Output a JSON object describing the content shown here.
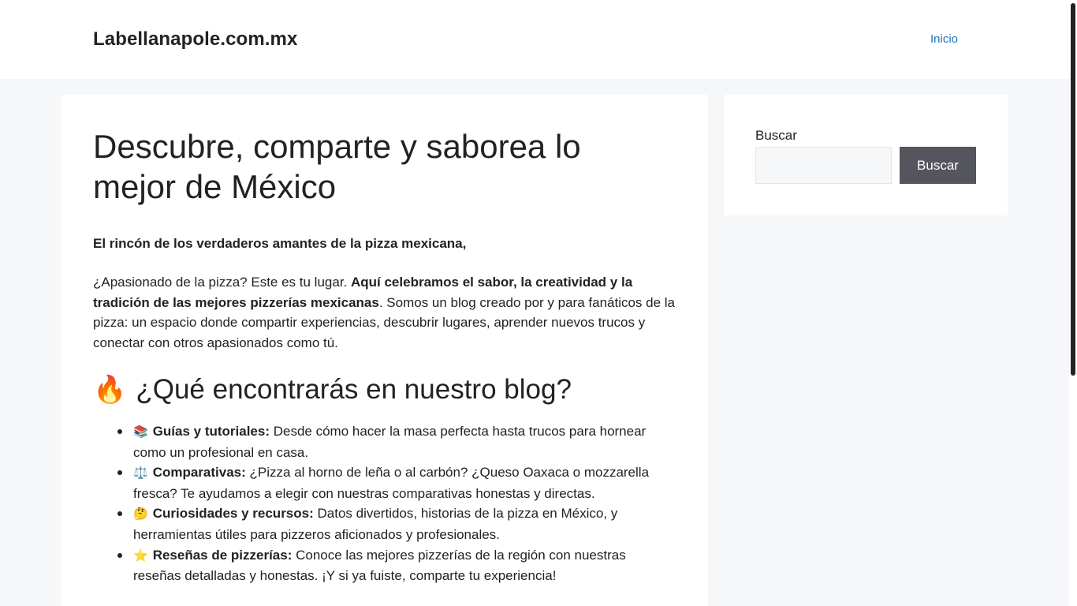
{
  "header": {
    "site_title": "Labellanapole.com.mx",
    "nav": {
      "home_label": "Inicio"
    }
  },
  "main": {
    "title": "Descubre, comparte y saborea lo mejor de México",
    "intro_bold": "El rincón de los verdaderos amantes de la pizza mexicana,",
    "paragraph": {
      "part1": "¿Apasionado de la pizza? Este es tu lugar. ",
      "bold": "Aquí celebramos el sabor, la creatividad y la tradición de las mejores pizzerías mexicanas",
      "part2": ". Somos un blog creado por y para fanáticos de la pizza: un espacio donde compartir experiencias, descubrir lugares, aprender nuevos trucos y conectar con otros apasionados como tú."
    },
    "section_heading": {
      "emoji": "🔥",
      "text": "¿Qué encontrarás en nuestro blog?"
    },
    "features": [
      {
        "emoji": "📚",
        "title": "Guías y tutoriales:",
        "text": " Desde cómo hacer la masa perfecta hasta trucos para hornear como un profesional en casa."
      },
      {
        "emoji": "⚖️",
        "title": "Comparativas:",
        "text": " ¿Pizza al horno de leña o al carbón? ¿Queso Oaxaca o mozzarella fresca? Te ayudamos a elegir con nuestras comparativas honestas y directas."
      },
      {
        "emoji": "🤔",
        "title": "Curiosidades y recursos:",
        "text": " Datos divertidos, historias de la pizza en México, y herramientas útiles para pizzeros aficionados y profesionales."
      },
      {
        "emoji": "⭐",
        "title": "Reseñas de pizzerías:",
        "text": " Conoce las mejores pizzerías de la región con nuestras reseñas detalladas y honestas. ¡Y si ya fuiste, comparte tu experiencia!"
      }
    ]
  },
  "sidebar": {
    "search": {
      "label": "Buscar",
      "value": "",
      "placeholder": "",
      "button_label": "Buscar"
    }
  },
  "colors": {
    "link": "#1e73be",
    "button_bg": "#55555e",
    "page_bg": "#f6f7f9"
  }
}
